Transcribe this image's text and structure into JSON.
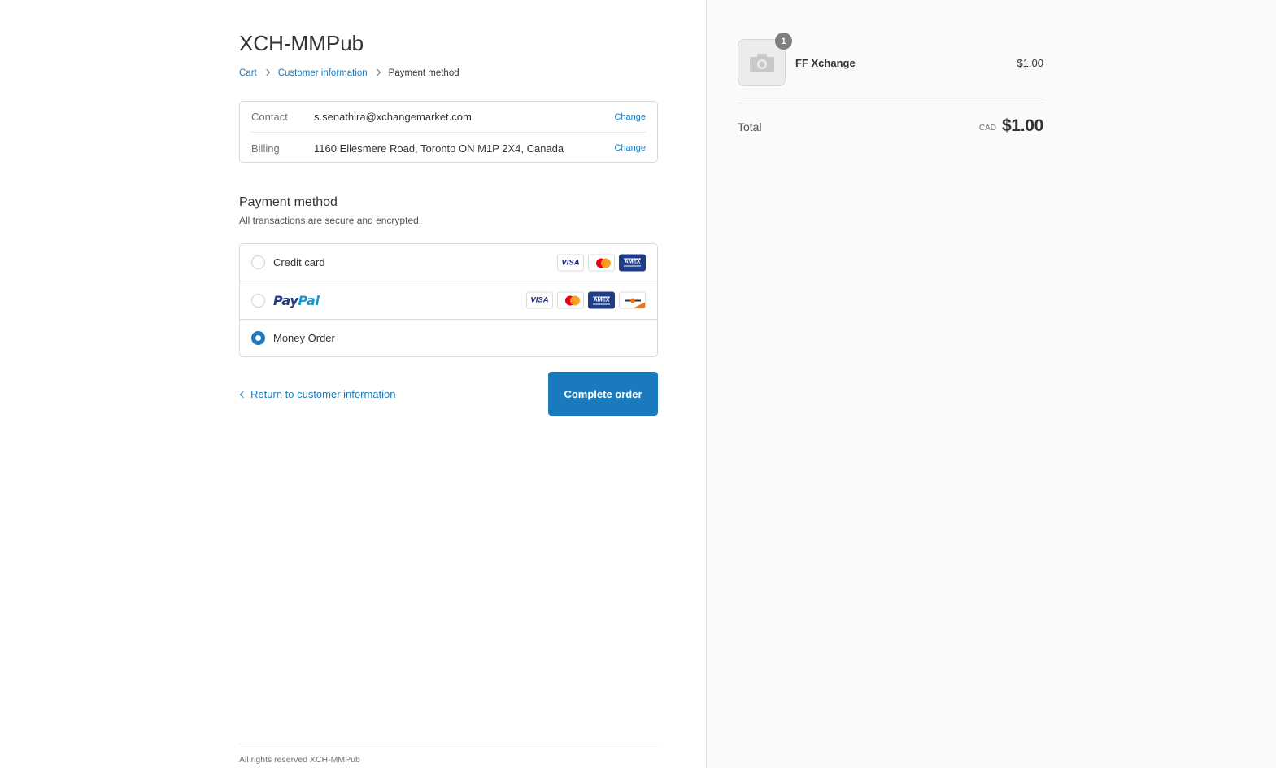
{
  "shop": {
    "title": "XCH-MMPub"
  },
  "breadcrumb": {
    "items": [
      {
        "label": "Cart"
      },
      {
        "label": "Customer information"
      },
      {
        "label": "Payment method"
      }
    ]
  },
  "review": {
    "contact": {
      "label": "Contact",
      "value": "s.senathira@xchangemarket.com",
      "change": "Change"
    },
    "billing": {
      "label": "Billing",
      "value": "1160 Ellesmere Road, Toronto ON M1P 2X4, Canada",
      "change": "Change"
    }
  },
  "payment": {
    "title": "Payment method",
    "subtitle": "All transactions are secure and encrypted.",
    "options": [
      {
        "label": "Credit card",
        "selected": false,
        "cards": [
          "visa-icon",
          "mastercard-icon",
          "amex-icon"
        ]
      },
      {
        "label": "PayPal",
        "selected": false,
        "cards": [
          "visa-icon",
          "mastercard-icon",
          "amex-icon",
          "discover-icon"
        ]
      },
      {
        "label": "Money Order",
        "selected": true
      }
    ],
    "card_labels": {
      "visa": "VISA",
      "amex": "AMEX"
    }
  },
  "actions": {
    "return_label": "Return to customer information",
    "complete_label": "Complete order"
  },
  "footer": {
    "text": "All rights reserved XCH-MMPub"
  },
  "summary": {
    "product": {
      "name": "FF Xchange",
      "price": "$1.00",
      "quantity": "1"
    },
    "total_label": "Total",
    "currency": "CAD",
    "total_amount": "$1.00"
  },
  "colors": {
    "accent": "#197bbd",
    "sidebar_bg": "#fafafa"
  }
}
